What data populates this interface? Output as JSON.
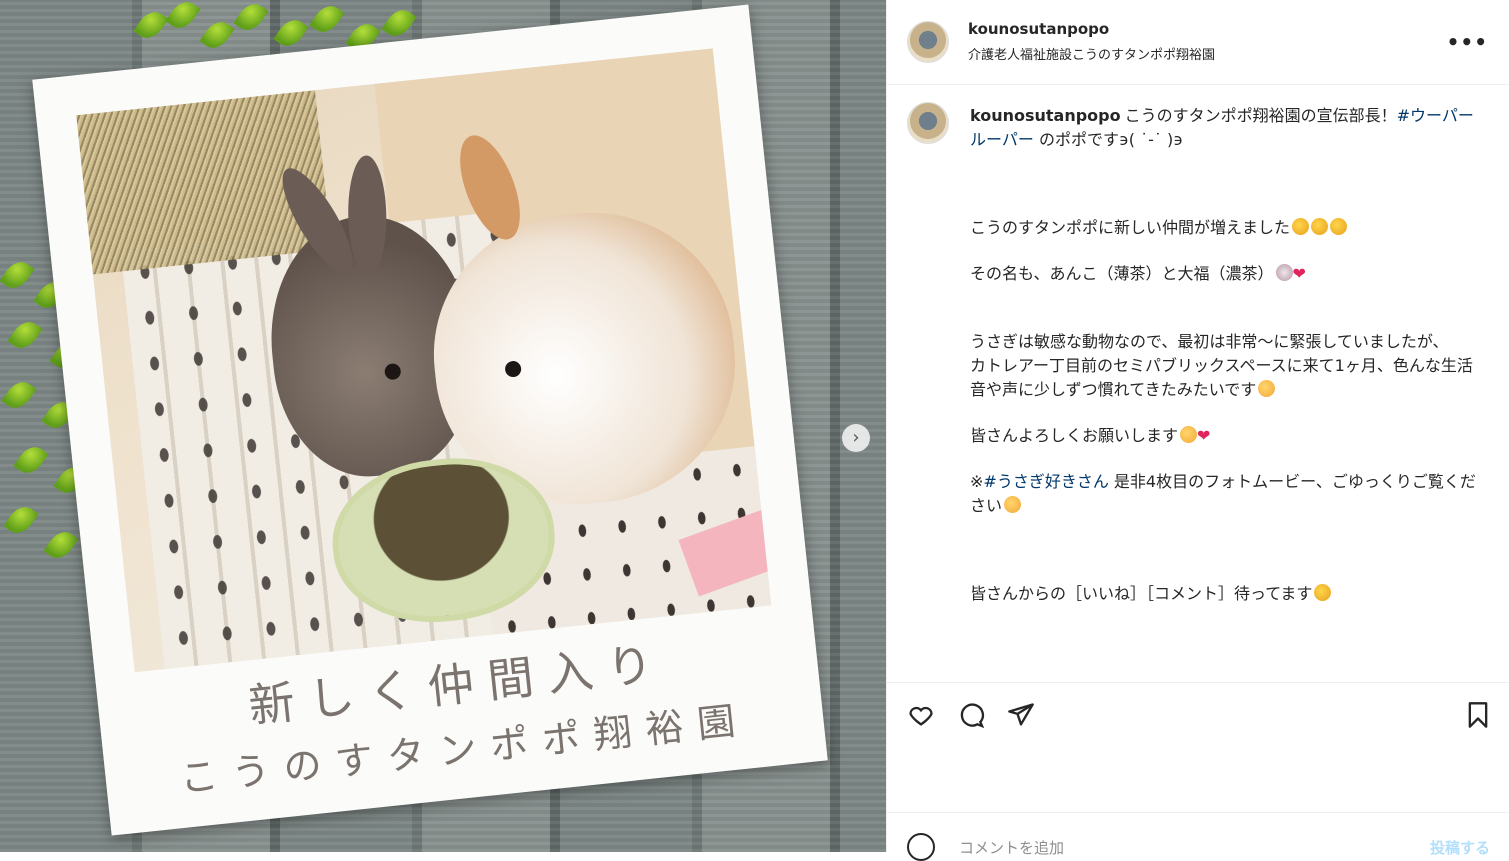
{
  "media": {
    "caption_line1": "新しく仲間入り",
    "caption_line2": "こうのすタンポポ翔裕園",
    "next_icon": "chevron-right-icon"
  },
  "header": {
    "username": "kounosutanpopo",
    "subtitle": "介護老人福祉施設こうのすタンポポ翔裕園",
    "more_icon": "more-horizontal-icon"
  },
  "caption": {
    "username": "kounosutanpopo",
    "intro": "こうのすタンポポ翔裕園の宣伝部長！",
    "hashtag1": "#ウーパールーパー",
    "intro_tail": "のポポです϶( ˙-˙ )϶",
    "line1": "こうのすタンポポに新しい仲間が増えました",
    "line2": "その名も、あんこ（薄茶）と大福（濃茶）",
    "line3a": "うさぎは敏感な動物なので、最初は非常〜に緊張していましたが、",
    "line3b": "カトレアー丁目前のセミパブリックスペースに来て1ヶ月、色んな生活音や声に少しずつ慣れてきたみたいです",
    "line4": "皆さんよろしくお願いします",
    "note_prefix": "※",
    "hashtag2": "#うさぎ好きさん",
    "note_body": " 是非4枚目のフォトムービー、ごゆっくりご覧ください",
    "line5": "皆さんからの［いいね］［コメント］待ってます"
  },
  "actions": {
    "like_icon": "heart-icon",
    "comment_icon": "comment-icon",
    "share_icon": "share-icon",
    "save_icon": "bookmark-icon"
  },
  "comment_bar": {
    "placeholder": "コメントを追加",
    "post_label": "投稿する"
  },
  "colors": {
    "link": "#00376b",
    "post_disabled": "#b2dffc",
    "heart": "#e0245e"
  }
}
